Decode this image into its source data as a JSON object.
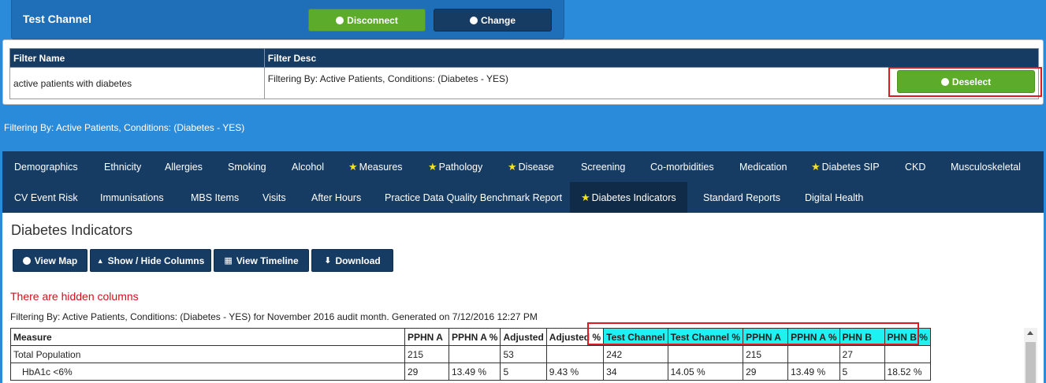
{
  "channel": {
    "title": "Test Channel",
    "disconnect_label": "Disconnect",
    "change_label": "Change"
  },
  "filter": {
    "headers": [
      "Filter Name",
      "Filter Desc"
    ],
    "name": "active patients with diabetes",
    "desc": "Filtering By: Active Patients, Conditions: (Diabetes - YES)",
    "deselect_label": "Deselect"
  },
  "filter_note": "Filtering By: Active Patients, Conditions: (Diabetes - YES)",
  "nav": {
    "row1": [
      "Demographics",
      "Ethnicity",
      "Allergies",
      "Smoking",
      "Alcohol",
      "Measures",
      "Pathology",
      "Disease",
      "Screening",
      "Co-morbidities",
      "Medication",
      "Diabetes SIP",
      "CKD",
      "Musculoskeletal"
    ],
    "row2": [
      "CV Event Risk",
      "Immunisations",
      "MBS Items",
      "Visits",
      "After Hours",
      "Practice Data Quality Benchmark Report",
      "Diabetes Indicators",
      "Standard Reports",
      "Digital Health"
    ]
  },
  "main": {
    "title": "Diabetes Indicators",
    "buttons": {
      "view_map": "View Map",
      "show_hide": "Show / Hide Columns",
      "timeline": "View Timeline",
      "download": "Download"
    },
    "hidden_cols": "There are hidden columns",
    "generated": "Filtering By: Active Patients, Conditions: (Diabetes - YES) for November 2016 audit month. Generated on 7/12/2016 12:27 PM"
  },
  "table": {
    "headers": [
      "Measure",
      "PPHN A",
      "PPHN A %",
      "Adjusted",
      "Adjusted %",
      "Test Channel",
      "Test Channel %",
      "PPHN A",
      "PPHN A %",
      "PHN B",
      "PHN B %"
    ],
    "rows": [
      [
        "Total Population",
        "215",
        "",
        "53",
        "",
        "242",
        "",
        "215",
        "",
        "27",
        ""
      ],
      [
        "HbA1c <6%",
        "29",
        "13.49 %",
        "5",
        "9.43 %",
        "34",
        "14.05 %",
        "29",
        "13.49 %",
        "5",
        "18.52 %"
      ]
    ]
  },
  "colors": {
    "accent_green": "#5cab2a",
    "navy": "#173c63",
    "highlight_cyan": "#1ff0f0",
    "alert_red": "#d0101a"
  }
}
